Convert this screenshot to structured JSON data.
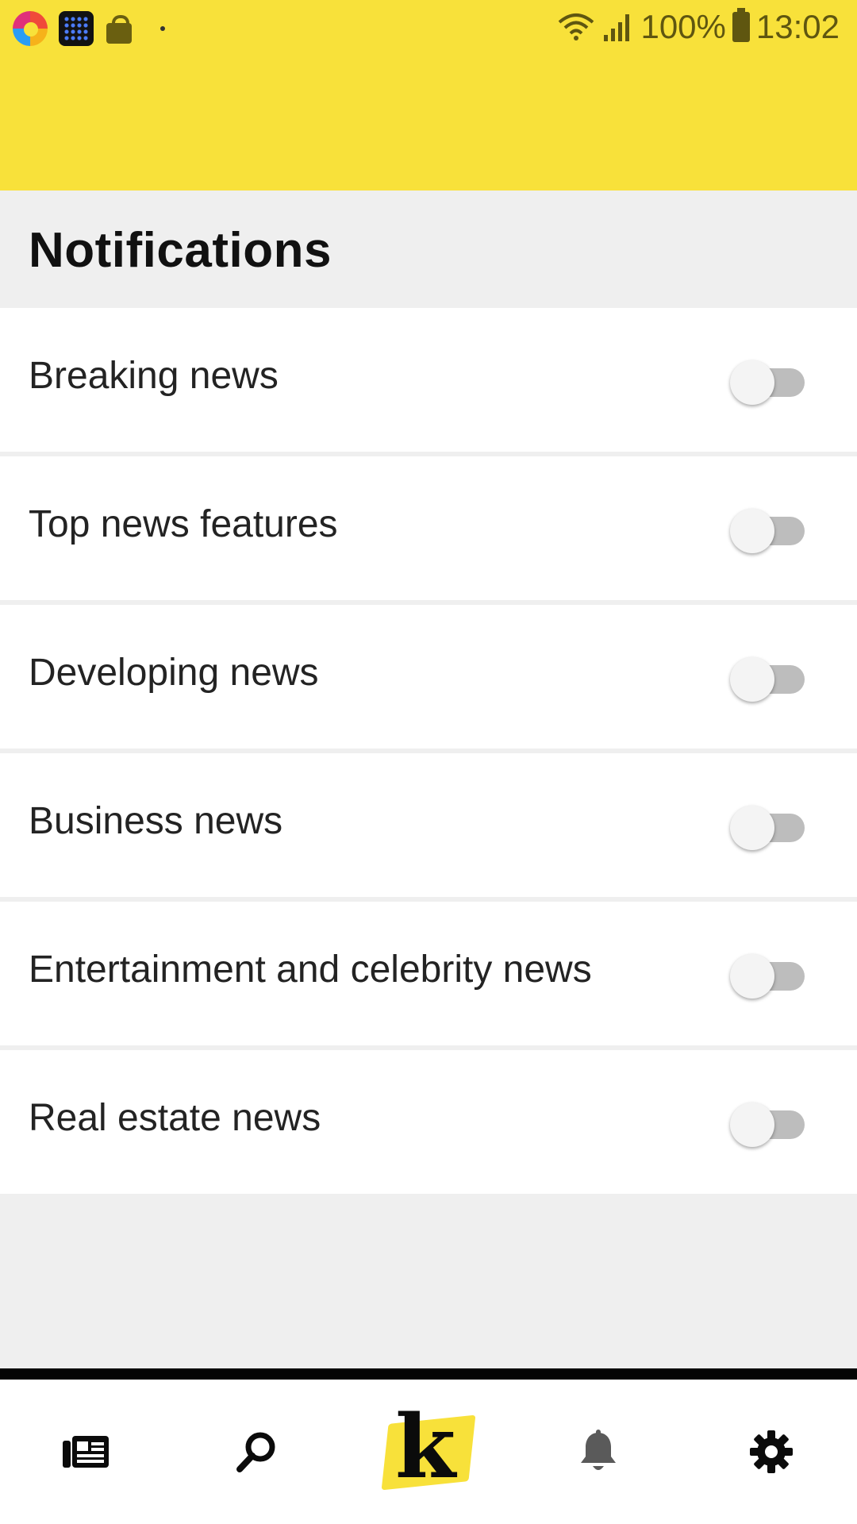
{
  "status_bar": {
    "battery": "100%",
    "time": "13:02"
  },
  "page": {
    "title": "Notifications"
  },
  "notification_settings": [
    {
      "label": "Breaking news",
      "enabled": false
    },
    {
      "label": "Top news features",
      "enabled": false
    },
    {
      "label": "Developing news",
      "enabled": false
    },
    {
      "label": "Business news",
      "enabled": false
    },
    {
      "label": "Entertainment and celebrity news",
      "enabled": false
    },
    {
      "label": "Real estate news",
      "enabled": false
    }
  ],
  "bottom_nav": {
    "items": [
      {
        "icon": "newspaper-icon"
      },
      {
        "icon": "search-icon"
      },
      {
        "icon": "logo-k-icon",
        "logo_letter": "k"
      },
      {
        "icon": "bell-icon"
      },
      {
        "icon": "gear-icon"
      }
    ]
  },
  "colors": {
    "accent": "#f8e13a",
    "background": "#efefef",
    "toggle_off_track": "#bdbdbd"
  }
}
